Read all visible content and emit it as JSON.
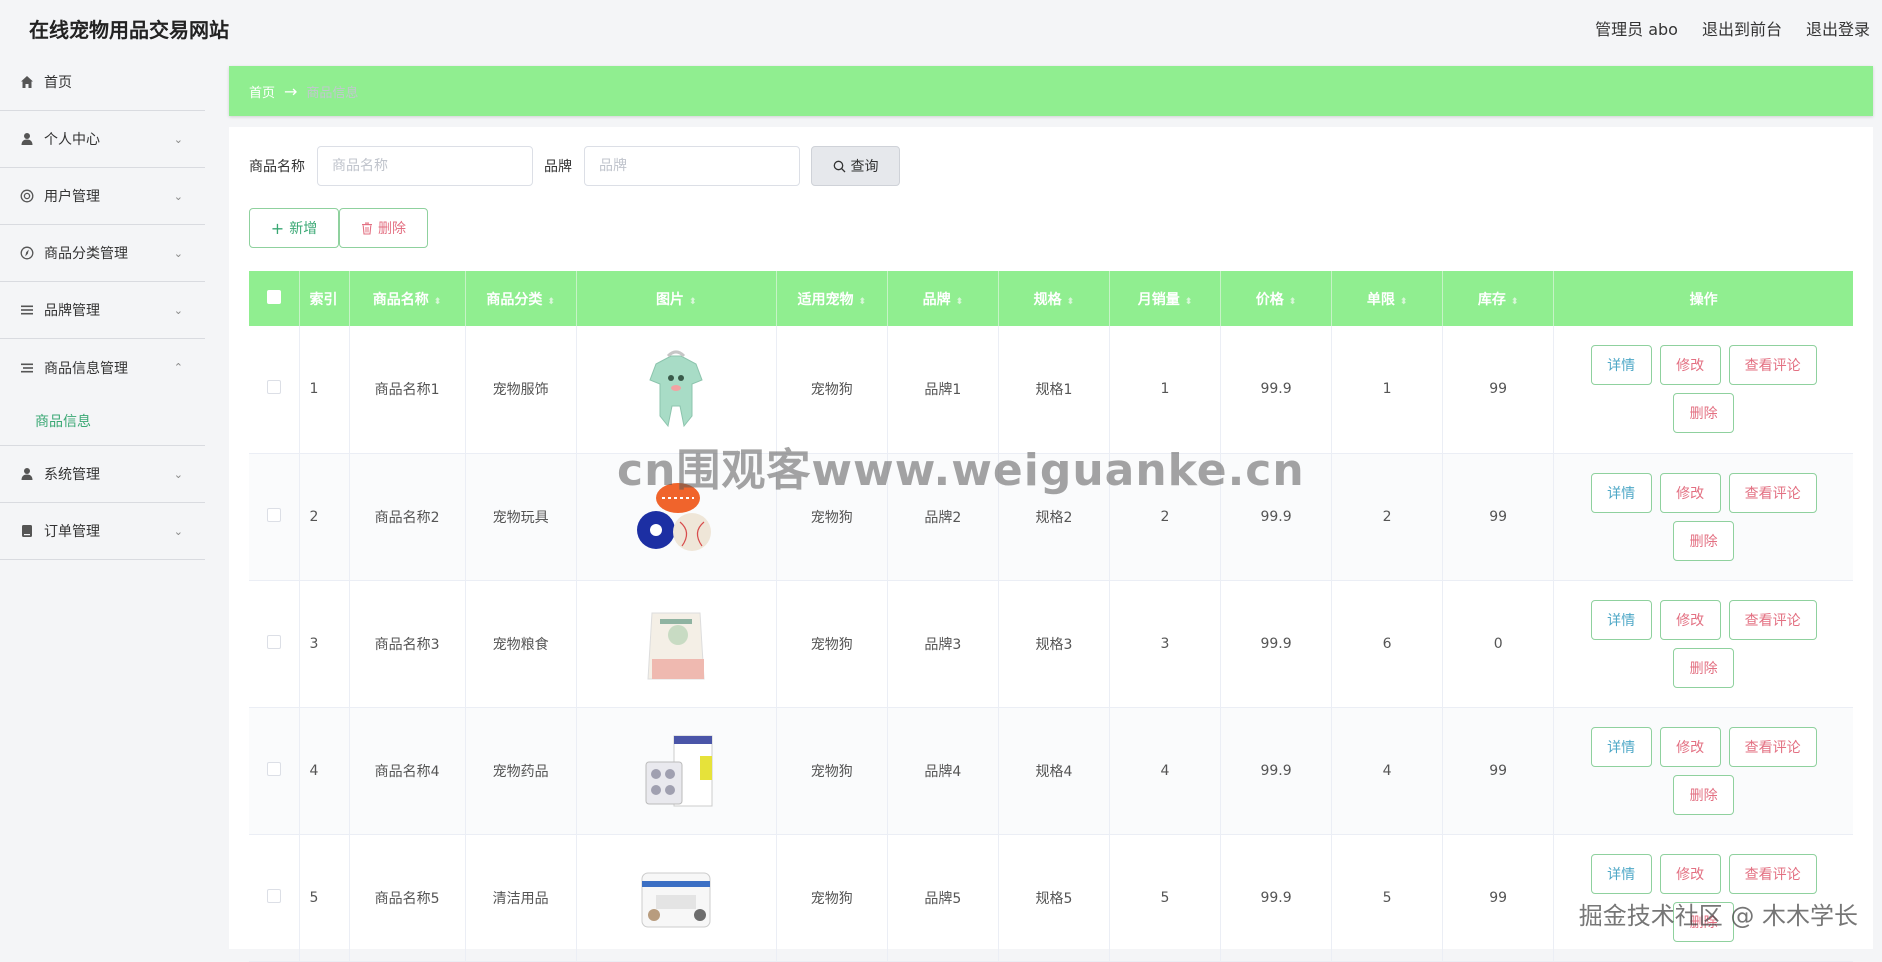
{
  "header": {
    "site_title": "在线宠物用品交易网站",
    "admin_label": "管理员 abo",
    "to_frontend": "退出到前台",
    "logout": "退出登录"
  },
  "sidebar": {
    "items": [
      {
        "label": "首页",
        "icon": "home-icon",
        "expandable": false
      },
      {
        "label": "个人中心",
        "icon": "user-icon",
        "expandable": true
      },
      {
        "label": "用户管理",
        "icon": "lifebuoy-icon",
        "expandable": true
      },
      {
        "label": "商品分类管理",
        "icon": "compass-icon",
        "expandable": true
      },
      {
        "label": "品牌管理",
        "icon": "list-icon",
        "expandable": true
      },
      {
        "label": "商品信息管理",
        "icon": "list-icon",
        "expandable": true,
        "open": true,
        "sub": "商品信息"
      },
      {
        "label": "系统管理",
        "icon": "user-icon",
        "expandable": true
      },
      {
        "label": "订单管理",
        "icon": "order-icon",
        "expandable": true
      }
    ]
  },
  "breadcrumb": {
    "home": "首页",
    "current": "商品信息"
  },
  "search": {
    "name_label": "商品名称",
    "name_placeholder": "商品名称",
    "brand_label": "品牌",
    "brand_placeholder": "品牌",
    "button": "查询"
  },
  "actions": {
    "add": "新增",
    "delete": "删除"
  },
  "table": {
    "headers": [
      "索引",
      "商品名称",
      "商品分类",
      "图片",
      "适用宠物",
      "品牌",
      "规格",
      "月销量",
      "价格",
      "单限",
      "库存",
      "操作"
    ],
    "rows": [
      {
        "idx": "1",
        "name": "商品名称1",
        "category": "宠物服饰",
        "pet": "宠物狗",
        "brand": "品牌1",
        "spec": "规格1",
        "sales": "1",
        "price": "99.9",
        "limit": "1",
        "stock": "99",
        "image": "pet-clothes-image"
      },
      {
        "idx": "2",
        "name": "商品名称2",
        "category": "宠物玩具",
        "pet": "宠物狗",
        "brand": "品牌2",
        "spec": "规格2",
        "sales": "2",
        "price": "99.9",
        "limit": "2",
        "stock": "99",
        "image": "pet-toy-balls-image"
      },
      {
        "idx": "3",
        "name": "商品名称3",
        "category": "宠物粮食",
        "pet": "宠物狗",
        "brand": "品牌3",
        "spec": "规格3",
        "sales": "3",
        "price": "99.9",
        "limit": "6",
        "stock": "0",
        "image": "pet-food-bag-image"
      },
      {
        "idx": "4",
        "name": "商品名称4",
        "category": "宠物药品",
        "pet": "宠物狗",
        "brand": "品牌4",
        "spec": "规格4",
        "sales": "4",
        "price": "99.9",
        "limit": "4",
        "stock": "99",
        "image": "pet-medicine-image"
      },
      {
        "idx": "5",
        "name": "商品名称5",
        "category": "清洁用品",
        "pet": "宠物狗",
        "brand": "品牌5",
        "spec": "规格5",
        "sales": "5",
        "price": "99.9",
        "limit": "5",
        "stock": "99",
        "image": "pet-wipes-image"
      }
    ],
    "ops": {
      "detail": "详情",
      "edit": "修改",
      "review": "查看评论",
      "delete": "删除"
    }
  },
  "watermarks": {
    "center": "cn围观客www.weiguanke.cn",
    "corner": "掘金技术社区 @ 木木学长"
  },
  "colors": {
    "accent": "#90ee90",
    "primary_text": "#3aa874",
    "danger_text": "#e37082",
    "info_text": "#4fa8c7"
  }
}
